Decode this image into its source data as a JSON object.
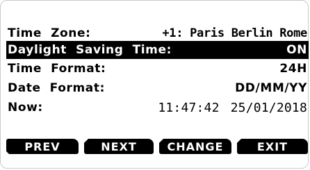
{
  "settings": {
    "time_zone": {
      "label": "Time  Zone:",
      "value": "+1: Paris Berlin Rome"
    },
    "daylight_saving": {
      "label": "Daylight  Saving  Time:",
      "value": "ON",
      "selected": true
    },
    "time_format": {
      "label": "Time  Format:",
      "value": "24H"
    },
    "date_format": {
      "label": "Date  Format:",
      "value": "DD/MM/YY"
    },
    "now": {
      "label": "Now:",
      "time": "11:47:42",
      "date": "25/01/2018"
    }
  },
  "softkeys": {
    "prev": "PREV",
    "next": "NEXT",
    "change": "CHANGE",
    "exit": "EXIT"
  },
  "colors": {
    "background": "#ffffff",
    "text": "#000000",
    "highlight": "#000000",
    "highlight_text": "#ffffff"
  }
}
